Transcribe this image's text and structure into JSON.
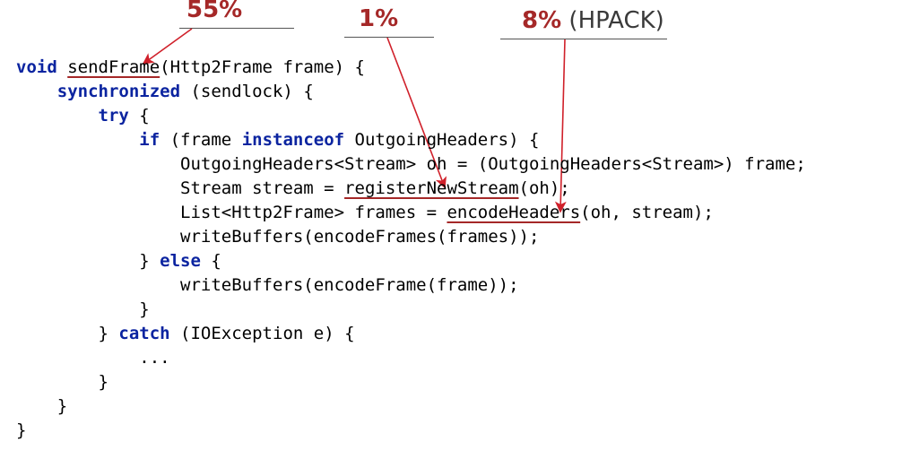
{
  "annotations": {
    "a1": {
      "percent": "55%",
      "extra": ""
    },
    "a2": {
      "percent": "1%",
      "extra": ""
    },
    "a3": {
      "percent": "8%",
      "extra": "(HPACK)"
    }
  },
  "code": {
    "l1": {
      "kw_void": "void",
      "fn": "sendFrame",
      "rest": "(Http2Frame frame) {"
    },
    "l2": {
      "kw_sync": "synchronized",
      "rest": " (sendlock) {"
    },
    "l3": {
      "kw_try": "try",
      "rest": " {"
    },
    "l4": {
      "kw_if": "if",
      "t1": " (frame ",
      "kw_inst": "instanceof",
      "t2": " OutgoingHeaders) {"
    },
    "l5": "OutgoingHeaders<Stream> oh = (OutgoingHeaders<Stream>) frame;",
    "l6": {
      "t1": "Stream stream = ",
      "fn": "registerNewStream",
      "t2": "(oh);"
    },
    "l7": {
      "t1": "List<Http2Frame> frames = ",
      "fn": "encodeHeaders",
      "t2": "(oh, stream);"
    },
    "l8": "writeBuffers(encodeFrames(frames));",
    "l9": {
      "t1": "} ",
      "kw_else": "else",
      "t2": " {"
    },
    "l10": "writeBuffers(encodeFrame(frame));",
    "l11": "}",
    "l12": {
      "t1": "} ",
      "kw_catch": "catch",
      "t2": " (IOException e) {"
    },
    "l13": "...",
    "l14": "}",
    "l15": "}",
    "l16": "}"
  }
}
